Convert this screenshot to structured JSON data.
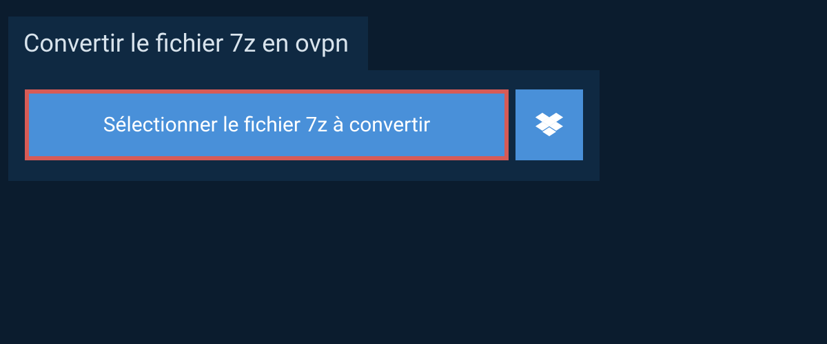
{
  "header": {
    "title": "Convertir le fichier 7z en ovpn"
  },
  "upload": {
    "select_button_label": "Sélectionner le fichier 7z à convertir",
    "dropbox_icon_name": "dropbox-icon"
  },
  "colors": {
    "background": "#0b1c2e",
    "panel": "#0f2942",
    "button": "#4990d9",
    "highlight_border": "#d75b56",
    "text_light": "#d8e3ec",
    "text_white": "#ffffff"
  }
}
